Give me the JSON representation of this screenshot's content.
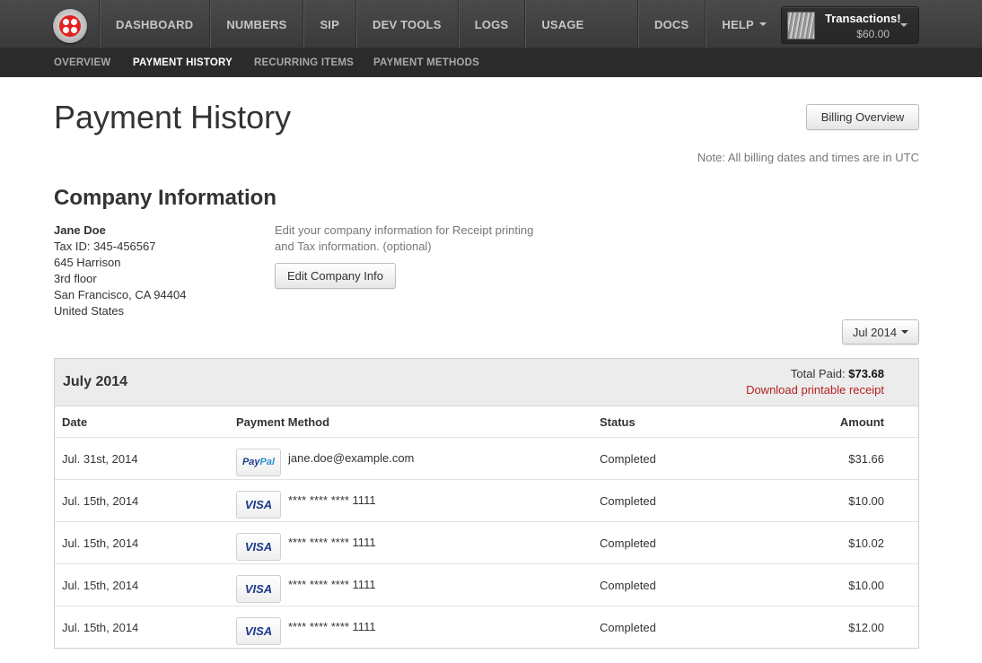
{
  "topnav": {
    "left_items": [
      "DASHBOARD",
      "NUMBERS",
      "SIP",
      "DEV TOOLS",
      "LOGS",
      "USAGE"
    ],
    "docs": "DOCS",
    "help": "HELP",
    "account": {
      "name": "Transactions!",
      "balance": "$60.00"
    }
  },
  "subnav": {
    "items": [
      "OVERVIEW",
      "PAYMENT HISTORY",
      "RECURRING ITEMS",
      "PAYMENT METHODS"
    ],
    "active": "PAYMENT HISTORY"
  },
  "page": {
    "title": "Payment History",
    "billing_overview_label": "Billing Overview",
    "note": "Note: All billing dates and times are in UTC"
  },
  "company": {
    "section_title": "Company Information",
    "name": "Jane Doe",
    "tax_id": "Tax ID: 345-456567",
    "address1": "645 Harrison",
    "address2": "3rd floor",
    "city": "San Francisco, CA 94404",
    "country": "United States",
    "edit_text": "Edit your company information for Receipt printing and Tax information. (optional)",
    "edit_label": "Edit Company Info"
  },
  "month_select": {
    "value": "Jul 2014"
  },
  "payments": {
    "month": "July 2014",
    "total_label": "Total Paid:",
    "total_value": "$73.68",
    "receipt_label": "Download printable receipt",
    "headers": {
      "date": "Date",
      "method": "Payment Method",
      "status": "Status",
      "amount": "Amount"
    },
    "rows": [
      {
        "date": "Jul. 31st, 2014",
        "card": "paypal",
        "method": "jane.doe@example.com",
        "status": "Completed",
        "amount": "$31.66"
      },
      {
        "date": "Jul. 15th, 2014",
        "card": "visa",
        "method": "**** **** **** 1111",
        "status": "Completed",
        "amount": "$10.00"
      },
      {
        "date": "Jul. 15th, 2014",
        "card": "visa",
        "method": "**** **** **** 1111",
        "status": "Completed",
        "amount": "$10.02"
      },
      {
        "date": "Jul. 15th, 2014",
        "card": "visa",
        "method": "**** **** **** 1111",
        "status": "Completed",
        "amount": "$10.00"
      },
      {
        "date": "Jul. 15th, 2014",
        "card": "visa",
        "method": "**** **** **** 1111",
        "status": "Completed",
        "amount": "$12.00"
      }
    ],
    "card_labels": {
      "visa": "VISA",
      "paypal_pay": "Pay",
      "paypal_pal": "Pal"
    }
  },
  "colors": {
    "link_red": "#b52222",
    "topbar": "#3a3a3a",
    "subnav": "#2b2b2b"
  }
}
